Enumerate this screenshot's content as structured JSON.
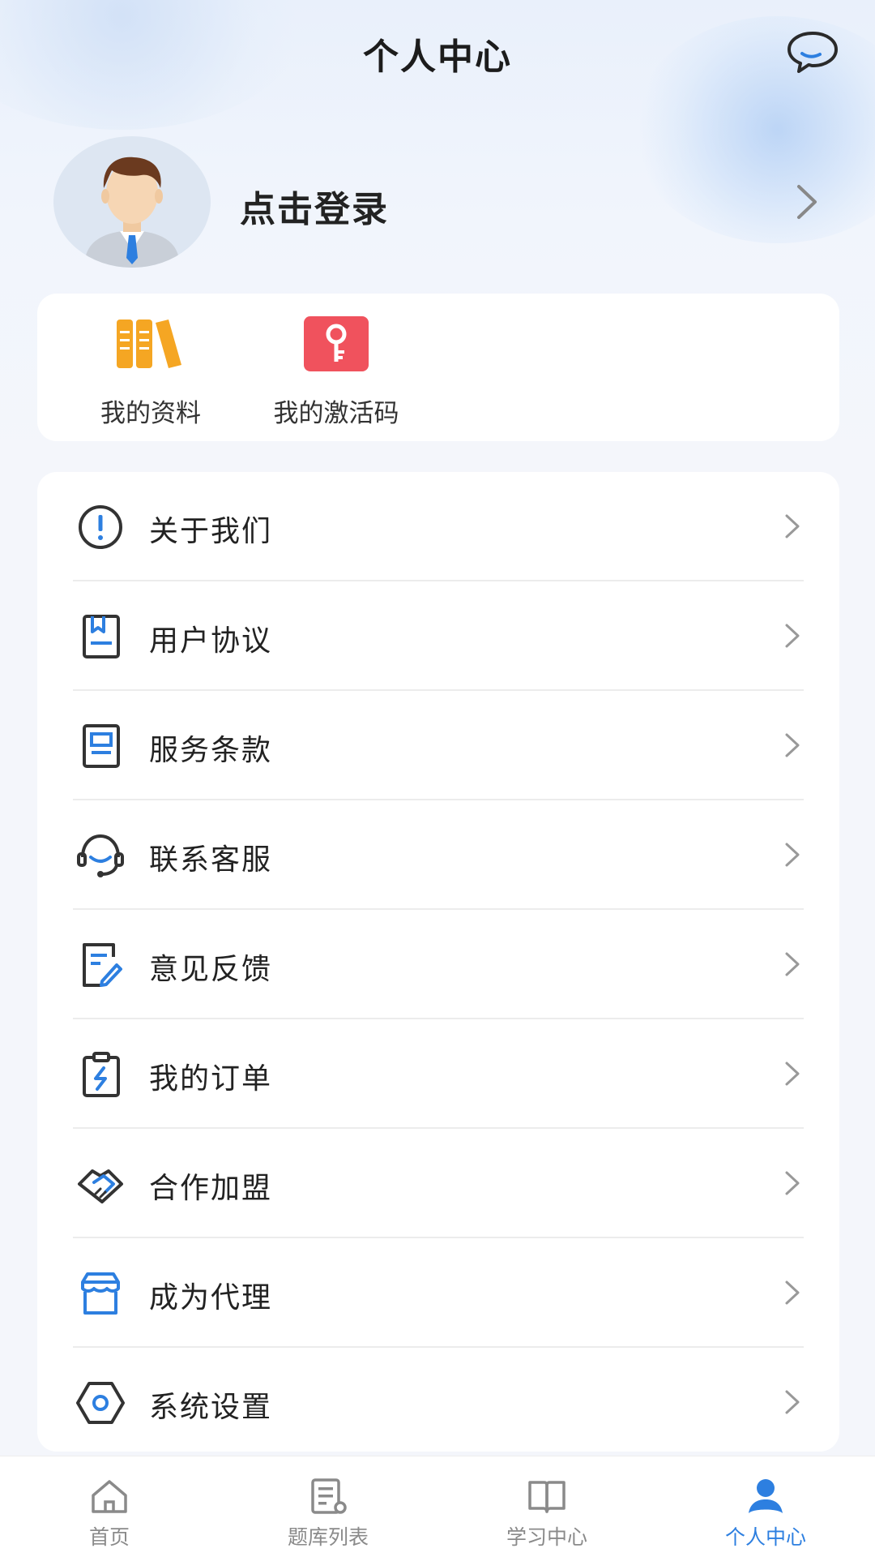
{
  "header": {
    "title": "个人中心",
    "message_icon": "chat-bubble-icon"
  },
  "profile": {
    "login_text": "点击登录",
    "avatar_icon": "user-avatar-icon"
  },
  "quick_actions": [
    {
      "label": "我的资料",
      "icon": "books-icon",
      "color": "#f5a623"
    },
    {
      "label": "我的激活码",
      "icon": "key-icon",
      "color": "#f0525d"
    }
  ],
  "menu": [
    {
      "label": "关于我们",
      "icon": "info-icon"
    },
    {
      "label": "用户协议",
      "icon": "agreement-icon"
    },
    {
      "label": "服务条款",
      "icon": "terms-icon"
    },
    {
      "label": "联系客服",
      "icon": "headset-icon"
    },
    {
      "label": "意见反馈",
      "icon": "feedback-icon"
    },
    {
      "label": "我的订单",
      "icon": "order-icon"
    },
    {
      "label": "合作加盟",
      "icon": "handshake-icon"
    },
    {
      "label": "成为代理",
      "icon": "store-icon"
    },
    {
      "label": "系统设置",
      "icon": "settings-icon"
    }
  ],
  "tabbar": [
    {
      "label": "首页",
      "icon": "home-icon",
      "active": false
    },
    {
      "label": "题库列表",
      "icon": "question-bank-icon",
      "active": false
    },
    {
      "label": "学习中心",
      "icon": "open-book-icon",
      "active": false
    },
    {
      "label": "个人中心",
      "icon": "person-icon",
      "active": true
    }
  ],
  "colors": {
    "accent": "#2d7fe0",
    "icon_dark": "#333333",
    "icon_blue": "#2d7fe0"
  }
}
